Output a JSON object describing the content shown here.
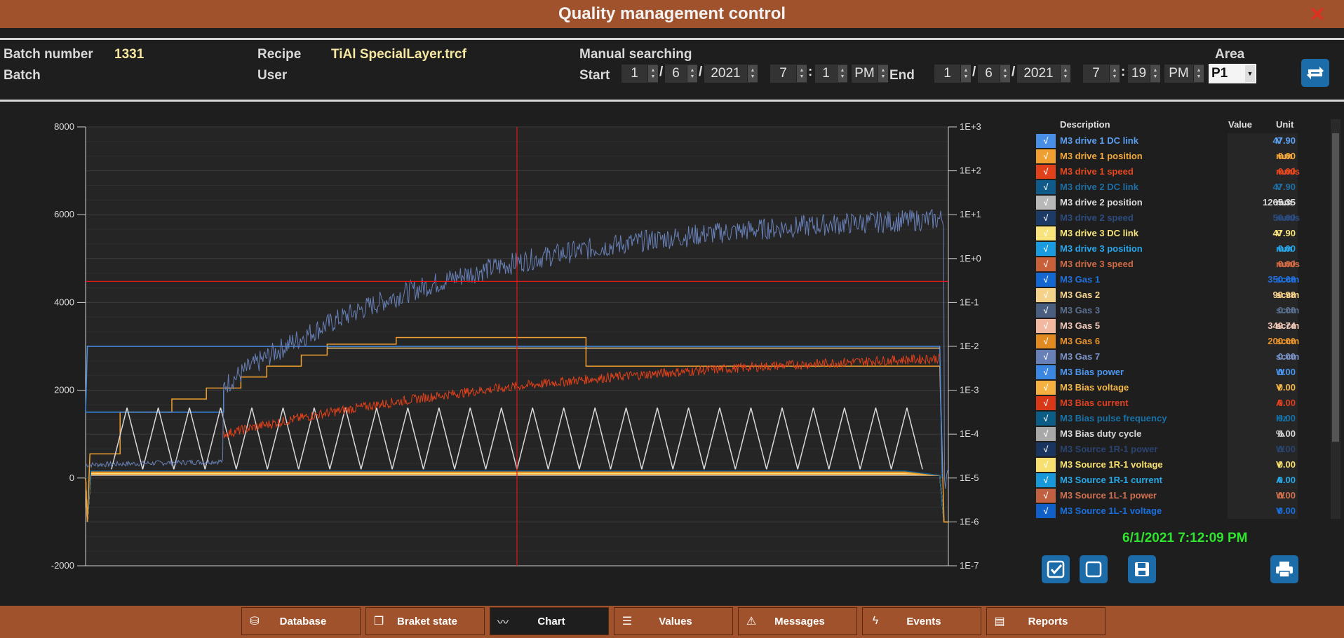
{
  "title": "Quality management control",
  "header": {
    "batch_number_label": "Batch number",
    "batch_number": "1331",
    "batch_label": "Batch",
    "recipe_label": "Recipe",
    "recipe": "TiAl SpecialLayer.trcf",
    "user_label": "User",
    "manual_searching": "Manual searching",
    "start_label": "Start",
    "end_label": "End",
    "start": {
      "day": "1",
      "month": "6",
      "year": "2021",
      "hour": "7",
      "minute": "1",
      "ampm": "PM"
    },
    "end": {
      "day": "1",
      "month": "6",
      "year": "2021",
      "hour": "7",
      "minute": "19",
      "ampm": "PM"
    },
    "area_label": "Area",
    "area_value": "P1"
  },
  "chart_data": {
    "type": "line",
    "left_axis": {
      "min": -2000,
      "max": 8000,
      "ticks": [
        "8000",
        "6000",
        "4000",
        "2000",
        "0",
        "-2000"
      ]
    },
    "right_axis": {
      "scale": "log",
      "ticks": [
        "1E+3",
        "1E+2",
        "1E+1",
        "1E+0",
        "1E-1",
        "1E-2",
        "1E-3",
        "1E-4",
        "1E-5",
        "1E-6",
        "1E-7"
      ]
    },
    "cursor_position_fraction": 0.5,
    "horizontal_marker_value": 4480,
    "grid": true
  },
  "legend": {
    "headers": {
      "description": "Description",
      "value": "Value",
      "unit": "Unit"
    },
    "check": "√",
    "rows": [
      {
        "desc": "M3 drive 1 DC link",
        "value": "47.90",
        "unit": "V",
        "color": "#4a8fe7",
        "text": "#5b9ff0"
      },
      {
        "desc": "M3 drive 1 position",
        "value": "0.00",
        "unit": "mm",
        "color": "#f0a030",
        "text": "#f2a83a"
      },
      {
        "desc": "M3 drive 1 speed",
        "value": "0.00",
        "unit": "mm/s",
        "color": "#e0401a",
        "text": "#e8481f"
      },
      {
        "desc": "M3 drive 2 DC link",
        "value": "47.90",
        "unit": "V",
        "color": "#105a8a",
        "text": "#1d6ea5"
      },
      {
        "desc": "M3 drive 2 position",
        "value": "1265.35",
        "unit": "mm",
        "color": "#b8b8b8",
        "text": "#dcdcdc"
      },
      {
        "desc": "M3 drive 2 speed",
        "value": "50.00",
        "unit": "mm/s",
        "color": "#1c3a66",
        "text": "#2b4c80"
      },
      {
        "desc": "M3 drive 3 DC link",
        "value": "47.90",
        "unit": "V",
        "color": "#f8e47a",
        "text": "#f8e47a"
      },
      {
        "desc": "M3 drive 3 position",
        "value": "0.00",
        "unit": "mm",
        "color": "#1a9be0",
        "text": "#28a6ea"
      },
      {
        "desc": "M3 drive 3 speed",
        "value": "0.00",
        "unit": "mm/s",
        "color": "#c8603a",
        "text": "#d06a44"
      },
      {
        "desc": "M3 Gas 1",
        "value": "350.66",
        "unit": "sccm",
        "color": "#1466d0",
        "text": "#1f70dd"
      },
      {
        "desc": "M3 Gas 2",
        "value": "99.98",
        "unit": "sccm",
        "color": "#f5d28a",
        "text": "#f5d28a"
      },
      {
        "desc": "M3 Gas 3",
        "value": "0.00",
        "unit": "sccm",
        "color": "#4a5f80",
        "text": "#5a6f90"
      },
      {
        "desc": "M3 Gas 5",
        "value": "349.74",
        "unit": "sccm",
        "color": "#f2b8a0",
        "text": "#f2c8b8"
      },
      {
        "desc": "M3 Gas 6",
        "value": "200.00",
        "unit": "sccm",
        "color": "#e08a20",
        "text": "#e8922a"
      },
      {
        "desc": "M3 Gas 7",
        "value": "0.00",
        "unit": "sccm",
        "color": "#6880b8",
        "text": "#7a92c8"
      },
      {
        "desc": "M3 Bias power",
        "value": "0.00",
        "unit": "W",
        "color": "#3a86e0",
        "text": "#4a96f0"
      },
      {
        "desc": "M3 Bias voltage",
        "value": "0.00",
        "unit": "V",
        "color": "#f5b040",
        "text": "#f5b848"
      },
      {
        "desc": "M3 Bias current",
        "value": "0.00",
        "unit": "A",
        "color": "#d83818",
        "text": "#e04020"
      },
      {
        "desc": "M3 Bias pulse frequency",
        "value": "0.00",
        "unit": "Hz",
        "color": "#0c5c88",
        "text": "#1672a8"
      },
      {
        "desc": "M3 Bias duty cycle",
        "value": "0.00",
        "unit": "%",
        "color": "#a8a8a8",
        "text": "#d8d8d8"
      },
      {
        "desc": "M3 Source 1R-1 power",
        "value": "0.00",
        "unit": "W",
        "color": "#1a3460",
        "text": "#2a4470"
      },
      {
        "desc": "M3 Source 1R-1 voltage",
        "value": "0.00",
        "unit": "V",
        "color": "#f8e070",
        "text": "#f8e070"
      },
      {
        "desc": "M3 Source 1R-1 current",
        "value": "0.00",
        "unit": "A",
        "color": "#1898d8",
        "text": "#28a8e8"
      },
      {
        "desc": "M3 Source 1L-1 power",
        "value": "0.00",
        "unit": "W",
        "color": "#c06040",
        "text": "#d07050"
      },
      {
        "desc": "M3 Source 1L-1 voltage",
        "value": "0.00",
        "unit": "V",
        "color": "#1060c8",
        "text": "#1870e0"
      }
    ]
  },
  "timestamp": "6/1/2021 7:12:09 PM",
  "nav": [
    {
      "label": "Database",
      "icon": "database-icon",
      "glyph": "⛁"
    },
    {
      "label": "Braket state",
      "icon": "book-icon",
      "glyph": "❐"
    },
    {
      "label": "Chart",
      "icon": "chart-icon",
      "glyph": "〰"
    },
    {
      "label": "Values",
      "icon": "list-icon",
      "glyph": "☰"
    },
    {
      "label": "Messages",
      "icon": "warning-icon",
      "glyph": "⚠"
    },
    {
      "label": "Events",
      "icon": "lightning-icon",
      "glyph": "ϟ"
    },
    {
      "label": "Reports",
      "icon": "report-icon",
      "glyph": "▤"
    }
  ],
  "active_nav": "Chart",
  "colors": {
    "titlebar": "#a0522d",
    "accent": "#1b6ca8",
    "timestamp": "#2ee52e"
  }
}
